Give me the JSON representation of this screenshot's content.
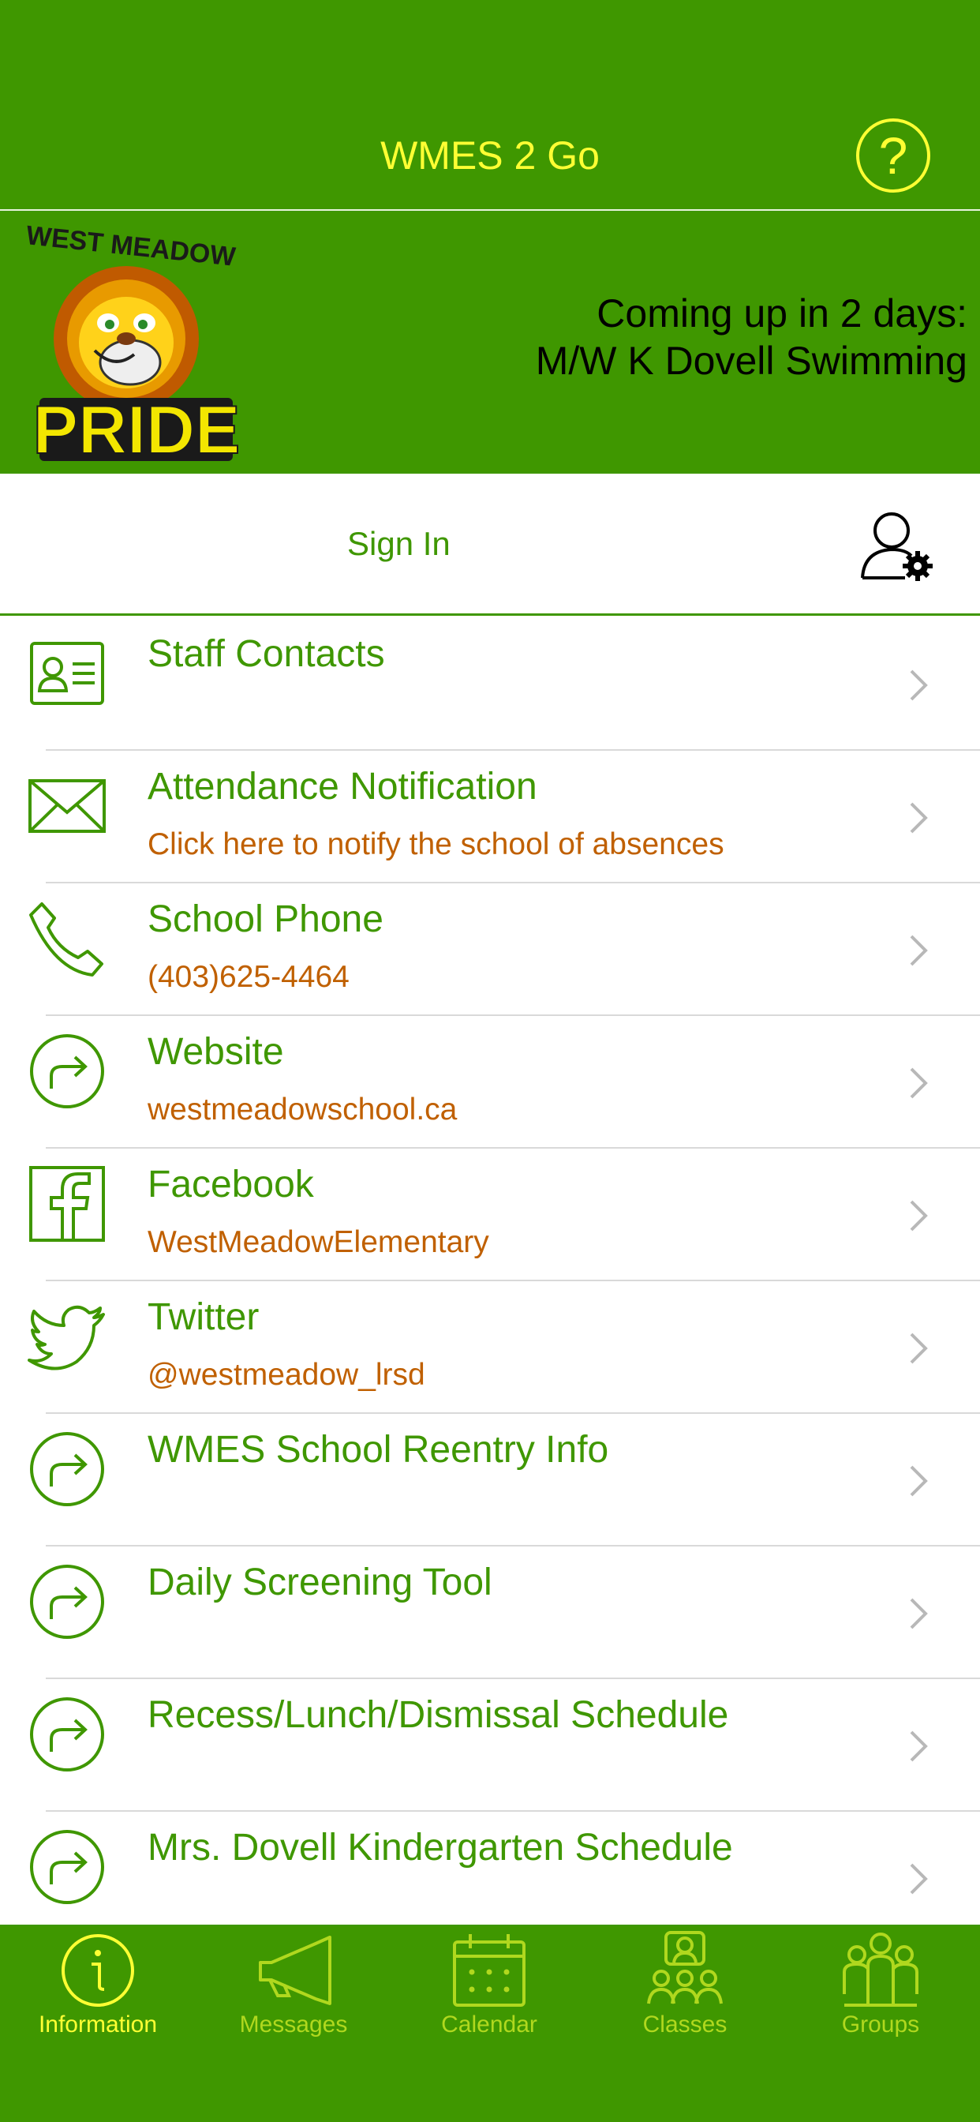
{
  "header": {
    "title": "WMES 2 Go",
    "help_icon": "question-circle-icon"
  },
  "banner": {
    "logo_text": "WEST MEADOW PRIDE",
    "announce_line1": "Coming up in 2 days:",
    "announce_line2": "M/W K Dovell Swimming"
  },
  "signin": {
    "label": "Sign In",
    "icon": "user-settings-icon"
  },
  "list": [
    {
      "title": "Staff Contacts",
      "subtitle": "",
      "icon": "contact-card-icon"
    },
    {
      "title": "Attendance Notification",
      "subtitle": "Click here to notify the school of absences",
      "icon": "envelope-icon"
    },
    {
      "title": "School Phone",
      "subtitle": "(403)625-4464",
      "icon": "phone-icon"
    },
    {
      "title": "Website",
      "subtitle": "westmeadowschool.ca",
      "icon": "link-arrow-icon"
    },
    {
      "title": "Facebook",
      "subtitle": "WestMeadowElementary",
      "icon": "facebook-icon"
    },
    {
      "title": "Twitter",
      "subtitle": "@westmeadow_lrsd",
      "icon": "twitter-icon"
    },
    {
      "title": "WMES School Reentry Info",
      "subtitle": "",
      "icon": "link-arrow-icon"
    },
    {
      "title": "Daily Screening Tool",
      "subtitle": "",
      "icon": "link-arrow-icon"
    },
    {
      "title": "Recess/Lunch/Dismissal Schedule",
      "subtitle": "",
      "icon": "link-arrow-icon"
    },
    {
      "title": "Mrs. Dovell Kindergarten Schedule",
      "subtitle": "",
      "icon": "link-arrow-icon"
    }
  ],
  "tabs": [
    {
      "label": "Information",
      "icon": "info-icon",
      "active": true
    },
    {
      "label": "Messages",
      "icon": "megaphone-icon",
      "active": false
    },
    {
      "label": "Calendar",
      "icon": "calendar-icon",
      "active": false
    },
    {
      "label": "Classes",
      "icon": "classes-icon",
      "active": false
    },
    {
      "label": "Groups",
      "icon": "groups-icon",
      "active": false
    }
  ],
  "colors": {
    "brand_green": "#3f9700",
    "header_yellow": "#ffff33",
    "subtitle_orange": "#c06000",
    "tab_inactive": "#b0d81e"
  }
}
